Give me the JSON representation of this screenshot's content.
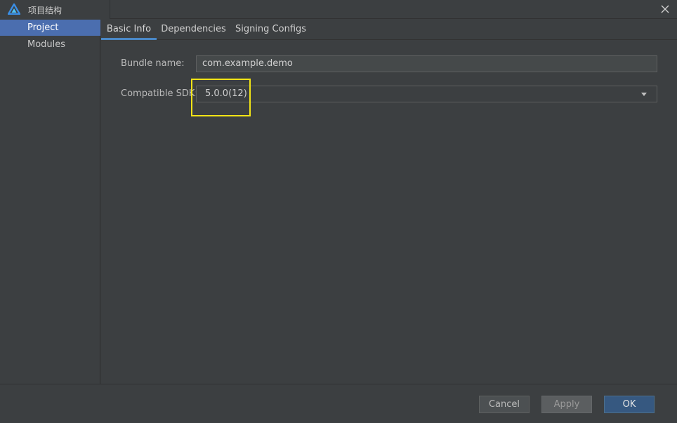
{
  "window": {
    "title": "项目结构",
    "app_icon": "deveco-logo-icon",
    "close_icon": "close-icon"
  },
  "sidebar": {
    "items": [
      {
        "label": "Project",
        "selected": true
      },
      {
        "label": "Modules",
        "selected": false
      }
    ]
  },
  "tabs": [
    {
      "label": "Basic Info",
      "active": true
    },
    {
      "label": "Dependencies",
      "active": false
    },
    {
      "label": "Signing Configs",
      "active": false
    }
  ],
  "form": {
    "bundle_name_label": "Bundle name:",
    "bundle_name_value": "com.example.demo",
    "sdk_label": "Compatible SDK:",
    "sdk_value": "5.0.0(12)"
  },
  "footer": {
    "cancel_label": "Cancel",
    "apply_label": "Apply",
    "ok_label": "OK"
  },
  "colors": {
    "selection": "#4b6eaf",
    "highlight_box": "#f2e416",
    "ok_button": "#365880"
  }
}
